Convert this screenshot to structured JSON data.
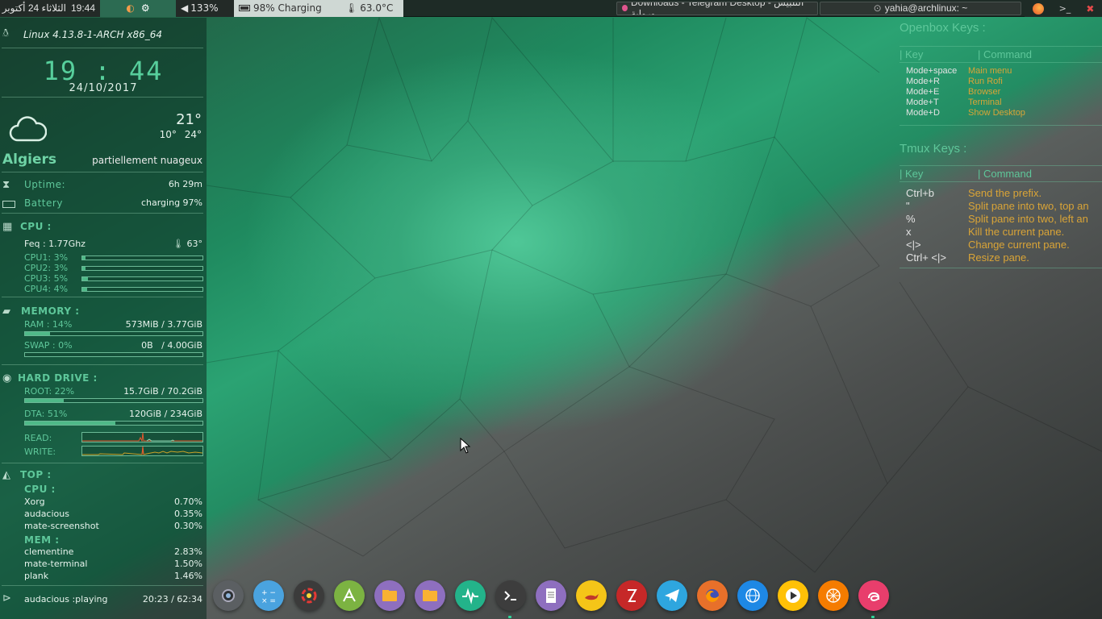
{
  "top_panel": {
    "clock": "19:44",
    "date": "الثلاثاء 24 أكتوبر",
    "volume": "133%",
    "battery": "98% Charging",
    "temperature": "63.0°C",
    "windows": [
      {
        "title": "Downloads - Telegram Desktop - التلبيس ورواية..."
      },
      {
        "title": "yahia@archlinux: ~"
      }
    ],
    "tray_icons": [
      "firefox-icon",
      "terminal-icon",
      "settings-icon"
    ]
  },
  "conky_left": {
    "kernel": "Linux 4.13.8-1-ARCH x86_64",
    "time": "19 : 44",
    "date": "24/10/2017",
    "weather": {
      "temp": "21°",
      "low": "10°",
      "high": "24°",
      "city": "Algiers",
      "condition": "partiellement nuageux"
    },
    "uptime": {
      "label": "Uptime:",
      "value": "6h 29m"
    },
    "battery": {
      "label": "Battery",
      "value": "charging 97%"
    },
    "cpu": {
      "heading": "CPU :",
      "freq": "Feq : 1.77Ghz",
      "temp": "63°",
      "cores": [
        {
          "label": "CPU1: 3%",
          "percent": 3
        },
        {
          "label": "CPU2: 3%",
          "percent": 3
        },
        {
          "label": "CPU3: 5%",
          "percent": 5
        },
        {
          "label": "CPU4: 4%",
          "percent": 4
        }
      ]
    },
    "memory": {
      "heading": "MEMORY :",
      "ram": {
        "label": "RAM : 14%",
        "value": "573MiB / 3.77GiB",
        "percent": 14
      },
      "swap": {
        "label": "SWAP : 0%",
        "value": "0B   / 4.00GiB",
        "percent": 0
      }
    },
    "disk": {
      "heading": "HARD DRIVE :",
      "root": {
        "label": "ROOT: 22%",
        "value": "15.7GiB / 70.2GiB",
        "percent": 22
      },
      "data": {
        "label": "DTA: 51%",
        "value": "120GiB / 234GiB",
        "percent": 51
      },
      "read_label": "READ:",
      "write_label": "WRITE:"
    },
    "top": {
      "heading": "TOP :",
      "cpu_heading": "CPU :",
      "cpu": [
        {
          "name": "Xorg",
          "value": "0.70%"
        },
        {
          "name": "audacious",
          "value": "0.35%"
        },
        {
          "name": "mate-screenshot",
          "value": "0.30%"
        }
      ],
      "mem_heading": "MEM :",
      "mem": [
        {
          "name": "clementine",
          "value": "2.83%"
        },
        {
          "name": "mate-terminal",
          "value": "1.50%"
        },
        {
          "name": "plank",
          "value": "1.46%"
        }
      ]
    },
    "player": {
      "status": "audacious :playing",
      "time": "20:23 / 62:34"
    }
  },
  "openbox": {
    "title": "Openbox Keys :",
    "key_header": "| Key",
    "cmd_header": "|  Command",
    "rows": [
      {
        "key": "Mode+space",
        "cmd": "Main menu"
      },
      {
        "key": "Mode+R",
        "cmd": "Run Rofi"
      },
      {
        "key": "Mode+E",
        "cmd": "Browser"
      },
      {
        "key": "Mode+T",
        "cmd": "Terminal"
      },
      {
        "key": "Mode+D",
        "cmd": "Show Desktop"
      }
    ]
  },
  "tmux": {
    "title": "Tmux Keys :",
    "key_header": "| Key",
    "cmd_header": "|  Command",
    "rows": [
      {
        "key": "Ctrl+b",
        "cmd": "Send the prefix."
      },
      {
        "key": "\"",
        "cmd": "Split pane into two, top an"
      },
      {
        "key": "%",
        "cmd": "Split pane into two, left an"
      },
      {
        "key": "x",
        "cmd": "Kill the current pane."
      },
      {
        "key": "<|>",
        "cmd": "Change current pane."
      },
      {
        "key": "Ctrl+ <|>",
        "cmd": "Resize pane."
      }
    ]
  },
  "dock": {
    "apps": [
      {
        "name": "system-settings-icon",
        "color": "#5b5f62"
      },
      {
        "name": "calculator-icon",
        "color": "#4aa3df"
      },
      {
        "name": "color-picker-icon",
        "color": "#3b3b3b"
      },
      {
        "name": "pdf-reader-icon",
        "color": "#7cb342"
      },
      {
        "name": "files-icon",
        "color": "#8e6fbf"
      },
      {
        "name": "files-folder-icon",
        "color": "#8e6fbf"
      },
      {
        "name": "system-monitor-icon",
        "color": "#23b38a"
      },
      {
        "name": "terminal-icon",
        "color": "#3d3d3d"
      },
      {
        "name": "text-editor-icon",
        "color": "#8e6fbf"
      },
      {
        "name": "lamp-app-icon",
        "color": "#f5c518"
      },
      {
        "name": "filezilla-icon",
        "color": "#c62828"
      },
      {
        "name": "telegram-icon",
        "color": "#2ea6df"
      },
      {
        "name": "firefox-icon",
        "color": "#e8702a"
      },
      {
        "name": "web-browser-icon",
        "color": "#1e88e5"
      },
      {
        "name": "media-player-icon",
        "color": "#ffc107"
      },
      {
        "name": "clementine-icon",
        "color": "#f57c00"
      },
      {
        "name": "audacious-icon",
        "color": "#e83e6c"
      }
    ]
  }
}
